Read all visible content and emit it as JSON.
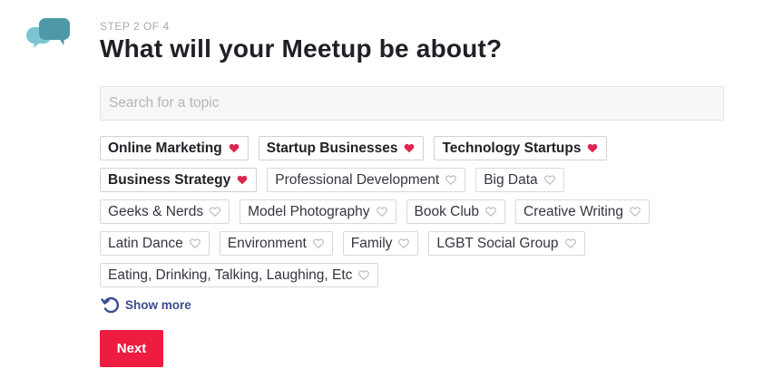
{
  "header": {
    "step_label": "STEP 2 OF 4",
    "title": "What will your Meetup be about?"
  },
  "search": {
    "placeholder": "Search for a topic",
    "value": ""
  },
  "topics": {
    "rows": [
      [
        {
          "label": "Online Marketing",
          "selected": true
        },
        {
          "label": "Startup Businesses",
          "selected": true
        },
        {
          "label": "Technology Startups",
          "selected": true
        }
      ],
      [
        {
          "label": "Business Strategy",
          "selected": true
        },
        {
          "label": "Professional Development",
          "selected": false
        },
        {
          "label": "Big Data",
          "selected": false
        }
      ],
      [
        {
          "label": "Geeks & Nerds",
          "selected": false
        },
        {
          "label": "Model Photography",
          "selected": false
        },
        {
          "label": "Book Club",
          "selected": false
        },
        {
          "label": "Creative Writing",
          "selected": false
        }
      ],
      [
        {
          "label": "Latin Dance",
          "selected": false
        },
        {
          "label": "Environment",
          "selected": false
        },
        {
          "label": "Family",
          "selected": false
        },
        {
          "label": "LGBT Social Group",
          "selected": false
        }
      ],
      [
        {
          "label": "Eating, Drinking, Talking, Laughing, Etc",
          "selected": false
        }
      ]
    ],
    "selected_icon": "filled-heart-icon",
    "unselected_icon": "outline-heart-icon"
  },
  "show_more": {
    "label": "Show more",
    "icon": "refresh-icon"
  },
  "actions": {
    "next_label": "Next"
  },
  "colors": {
    "heart_selected": "#e0234e",
    "heart_unselected": "#b9b9b9",
    "show_more": "#3c4c91",
    "next_button": "#ed1c40",
    "logo_back": "#7dc4d2",
    "logo_front": "#4f98a8"
  }
}
